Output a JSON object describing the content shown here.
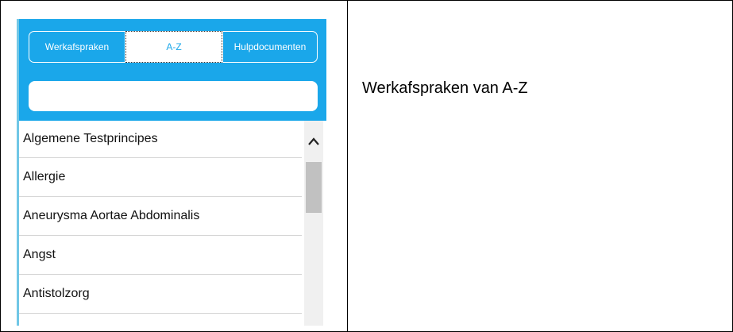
{
  "tabs": {
    "left": "Werkafspraken",
    "middle": "A-Z",
    "right": "Hulpdocumenten"
  },
  "search": {
    "value": "",
    "placeholder": ""
  },
  "list": [
    "Algemene Testprincipes",
    "Allergie",
    "Aneurysma Aortae Abdominalis",
    "Angst",
    "Antistolzorg"
  ],
  "caption": "Werkafspraken van A-Z",
  "colors": {
    "header": "#1aa7ea",
    "accent_border": "#70c7e6",
    "scrollbar": "#f0f0f0",
    "thumb": "#c1c1c1"
  }
}
